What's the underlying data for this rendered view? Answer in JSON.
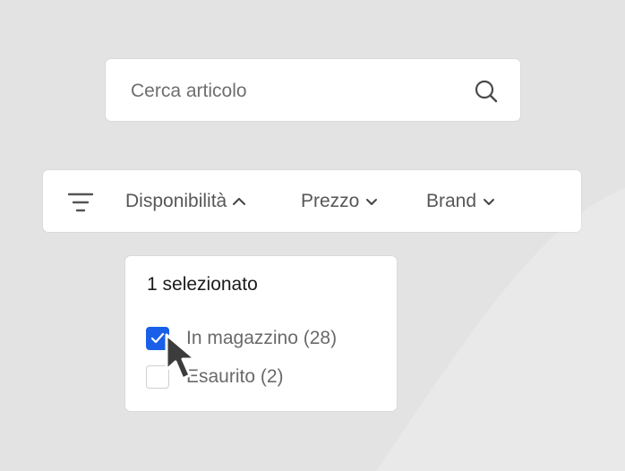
{
  "search": {
    "placeholder": "Cerca articolo",
    "icon": "search-icon"
  },
  "filters": {
    "icon": "filter-lines-icon",
    "items": [
      {
        "label": "Disponibilità",
        "icon": "chevron-up-icon",
        "expanded": true
      },
      {
        "label": "Prezzo",
        "icon": "chevron-down-icon",
        "expanded": false
      },
      {
        "label": "Brand",
        "icon": "chevron-down-icon",
        "expanded": false
      }
    ]
  },
  "dropdown": {
    "title": "1 selezionato",
    "options": [
      {
        "label": "In magazzino (28)",
        "checked": true
      },
      {
        "label": "Esaurito (2)",
        "checked": false
      }
    ]
  },
  "colors": {
    "background": "#e3e3e3",
    "surface": "#ffffff",
    "accent": "#1a5fe8",
    "text_muted": "#6a6a6a"
  }
}
